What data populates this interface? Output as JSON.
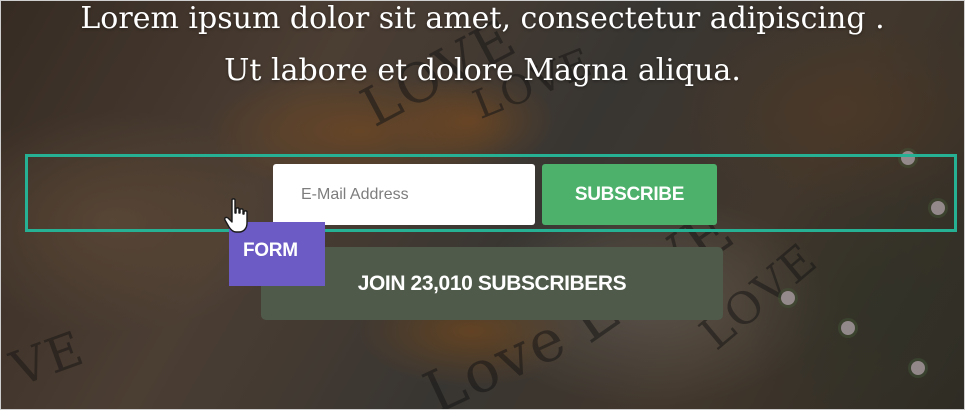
{
  "hero": {
    "headline_line1": "Lorem ipsum dolor sit amet, consectetur adipiscing .",
    "headline_line2": "Ut labore et dolore Magna aliqua."
  },
  "form": {
    "tag_label": "FORM",
    "email_placeholder": "E-Mail Address",
    "email_value": "",
    "subscribe_label": "SUBSCRIBE",
    "join_label": "JOIN 23,010 SUBSCRIBERS"
  },
  "background_text": [
    "LOVE",
    "LOVE",
    "Love",
    "LOVE",
    "LOVE",
    "VE"
  ],
  "colors": {
    "outline": "#26b194",
    "subscribe": "#4db06b",
    "join": "#4f5a4a",
    "form_tag": "#6c5bc4"
  },
  "icons": {
    "cursor": "hand-pointer-icon"
  }
}
